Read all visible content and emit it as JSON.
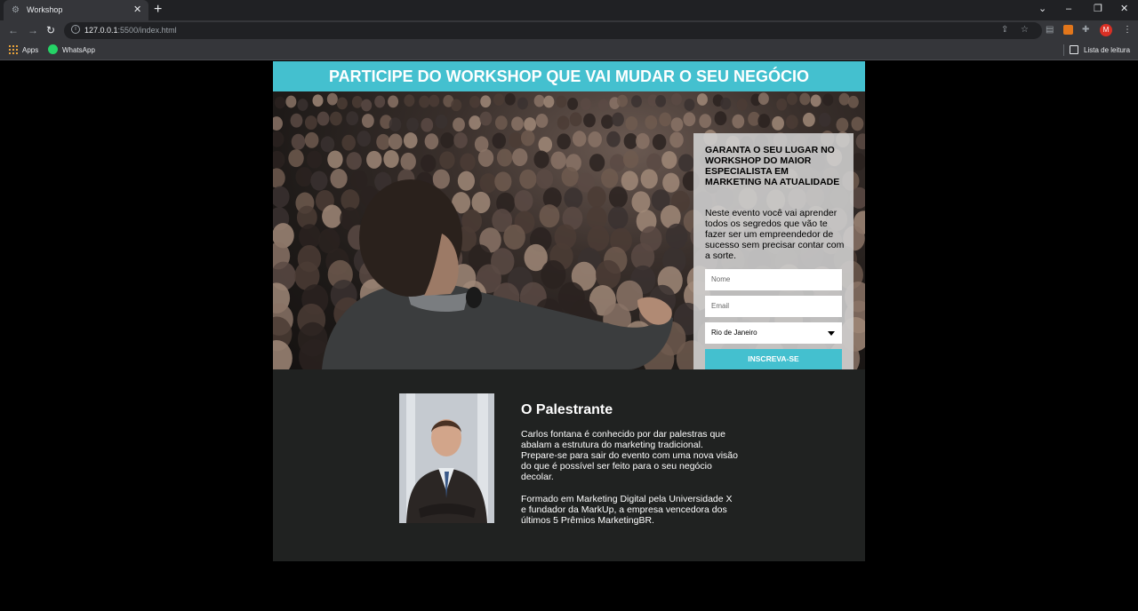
{
  "browser": {
    "tab_title": "Workshop",
    "url_host": "127.0.0.1",
    "url_rest": ":5500/index.html",
    "bookmarks": [
      "Apps",
      "WhatsApp"
    ],
    "reading_list": "Lista de leitura",
    "avatar_letter": "M"
  },
  "banner": {
    "title": "PARTICIPE DO WORKSHOP QUE VAI MUDAR O SEU NEGÓCIO"
  },
  "form": {
    "title": "GARANTA O SEU LUGAR NO WORKSHOP DO MAIOR ESPECIALISTA EM MARKETING NA ATUALIDADE",
    "description": "Neste evento você vai aprender todos os segredos que vão te fazer ser um empreendedor de sucesso sem precisar contar com a sorte.",
    "name_placeholder": "Nome",
    "email_placeholder": "Email",
    "city_selected": "Rio de Janeiro",
    "submit_label": "INSCREVA-SE"
  },
  "speaker": {
    "title": "O Palestrante",
    "bio_1": "Carlos fontana é conhecido por dar palestras que abalam a estrutura do marketing tradicional. Prepare-se para sair do evento com uma nova visão do que é possível ser feito para o seu negócio decolar.",
    "bio_2": "Formado em Marketing Digital pela Universidade X e fundador da MarkUp, a empresa vencedora dos últimos 5 Prêmios MarketingBR."
  },
  "colors": {
    "accent": "#44c0cf",
    "section_bg": "#202221",
    "page_bg": "#000000"
  }
}
